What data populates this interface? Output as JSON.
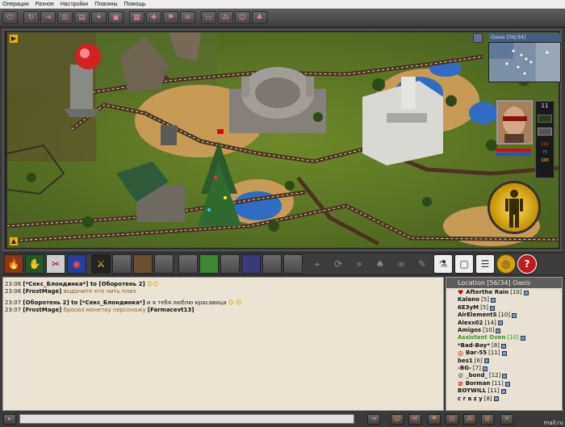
{
  "menu": {
    "items": [
      "Операции",
      "Разное",
      "Настройки",
      "Плагины",
      "Помощь"
    ]
  },
  "toolbar": {
    "buttons": [
      "exit-icon",
      "reload-icon",
      "login-icon",
      "trade-icon",
      "inventory-icon",
      "skills-icon",
      "quests-icon",
      "map-icon",
      "potion-icon",
      "clan-icon",
      "mail-icon",
      "save-icon",
      "group-icon",
      "friends-icon",
      "gift-icon"
    ]
  },
  "minimap": {
    "title": "Oasis [56/34]"
  },
  "character": {
    "level": "11",
    "stat_lines": [
      "100",
      "75",
      "100"
    ]
  },
  "action_bar": {
    "skills": [
      "fire-skill-icon",
      "heal-skill-icon",
      "weapon-skill-icon",
      "eye-skill-icon",
      "team-skill-icon"
    ]
  },
  "chat": {
    "lines": [
      {
        "time": "23:06",
        "nick": "[*Секс_Блондинка*] to [Оборотень 2]",
        "text": ""
      },
      {
        "time": "23:06",
        "nick": "[FrostMage]",
        "text": "выдачите кто нить плиз"
      },
      {
        "time": "23:07",
        "nick": "[Оборотень 2] to [*Секс_Блондинка*]",
        "text": "и я тебя люблю красавица"
      },
      {
        "time": "23:07",
        "nick": "[FrostMage]",
        "text": "бросил монетку персонажу",
        "target": "[Farmacevt13]"
      }
    ]
  },
  "player_list": {
    "header": "Location [56/34] Oasis",
    "players": [
      {
        "name": "Afterthe Rain",
        "level": "[10]",
        "color": "#111111",
        "icon": "heart"
      },
      {
        "name": "Kalano",
        "level": "[5]",
        "color": "#111111",
        "icon": ""
      },
      {
        "name": "6E3yM",
        "level": "[5]",
        "color": "#111111",
        "icon": ""
      },
      {
        "name": "AirElementS",
        "level": "[10]",
        "color": "#111111",
        "icon": ""
      },
      {
        "name": "Alexx02",
        "level": "[14]",
        "color": "#111111",
        "icon": ""
      },
      {
        "name": "Amigos",
        "level": "[10]",
        "color": "#111111",
        "icon": ""
      },
      {
        "name": "Assistant Oven",
        "level": "[10]",
        "color": "#2e9a20",
        "icon": ""
      },
      {
        "name": "*Bad-Boy*",
        "level": "[8]",
        "color": "#111111",
        "icon": ""
      },
      {
        "name": "Bar-55",
        "level": "[11]",
        "color": "#111111",
        "icon": "target"
      },
      {
        "name": "bes1",
        "level": "[6]",
        "color": "#111111",
        "icon": ""
      },
      {
        "name": "-BG-",
        "level": "[7]",
        "color": "#111111",
        "icon": ""
      },
      {
        "name": "_bond_",
        "level": "[12]",
        "color": "#111111",
        "icon": "gear"
      },
      {
        "name": "Borman",
        "level": "[11]",
        "color": "#111111",
        "icon": "ban"
      },
      {
        "name": "BOYWILL",
        "level": "[11]",
        "color": "#111111",
        "icon": ""
      },
      {
        "name": "c r a z y",
        "level": "[8]",
        "color": "#111111",
        "icon": ""
      }
    ]
  },
  "statusbar": {
    "brand": "mail.ru"
  }
}
